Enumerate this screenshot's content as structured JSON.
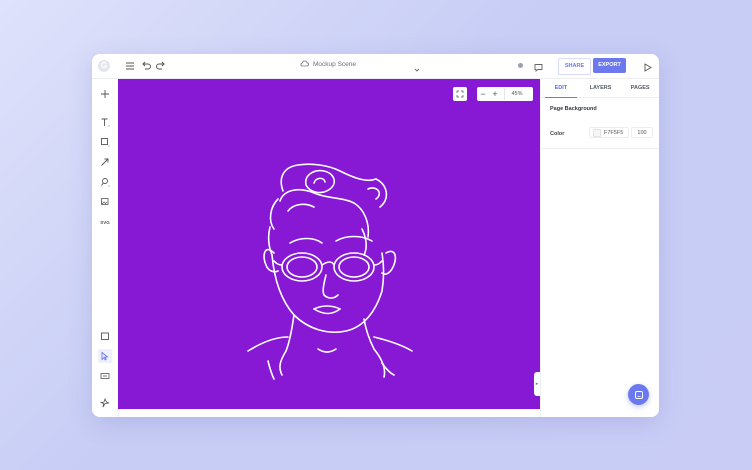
{
  "topbar": {
    "logo_glyph": "G",
    "scene_name": "Mockup Scene",
    "share_label": "SHARE",
    "export_label": "EXPORT",
    "icons": [
      "menu-icon",
      "undo-icon",
      "redo-icon",
      "cloud-icon",
      "chevron-down-icon",
      "status-dot-icon",
      "comment-icon",
      "play-icon"
    ]
  },
  "left_toolbar": {
    "tools": [
      "add-icon",
      "text-icon",
      "rectangle-icon",
      "arrow-icon",
      "zoom-tool-icon",
      "image-icon",
      "svg-icon",
      "frame-icon",
      "select-icon",
      "component-icon",
      "pin-icon"
    ],
    "svg_label": "SVG"
  },
  "canvas": {
    "background": "#8718d3",
    "zoom_value": "45%",
    "zoom_minus": "−",
    "zoom_plus": "+",
    "collapse_glyph": "▸"
  },
  "panel": {
    "tabs": [
      {
        "label": "EDIT",
        "active": true
      },
      {
        "label": "LAYERS",
        "active": false
      },
      {
        "label": "PAGES",
        "active": false
      }
    ],
    "section_title": "Page Background",
    "color_label": "Color",
    "color_value": "F7F5F5",
    "opacity_value": "100"
  },
  "colors": {
    "accent": "#6c78ee",
    "artboard": "#8718d3",
    "swatch": "#f7f5f5"
  }
}
